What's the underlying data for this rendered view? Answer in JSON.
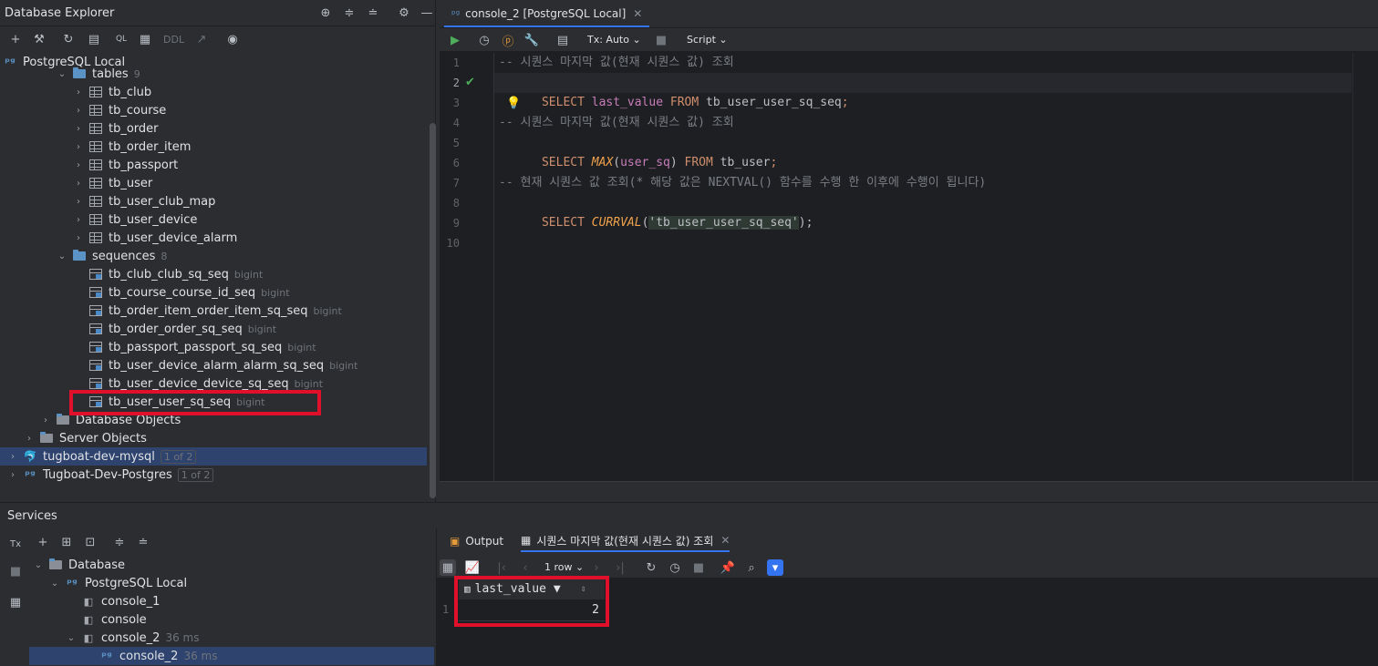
{
  "explorer": {
    "title": "Database Explorer",
    "toolbar_ddl": "DDL",
    "root": "PostgreSQL Local",
    "tables_folder": "tables",
    "tables_count": "9",
    "tables": [
      "tb_club",
      "tb_course",
      "tb_order",
      "tb_order_item",
      "tb_passport",
      "tb_user",
      "tb_user_club_map",
      "tb_user_device",
      "tb_user_device_alarm"
    ],
    "sequences_folder": "sequences",
    "sequences_count": "8",
    "sequences": [
      {
        "name": "tb_club_club_sq_seq",
        "type": "bigint"
      },
      {
        "name": "tb_course_course_id_seq",
        "type": "bigint"
      },
      {
        "name": "tb_order_item_order_item_sq_seq",
        "type": "bigint"
      },
      {
        "name": "tb_order_order_sq_seq",
        "type": "bigint"
      },
      {
        "name": "tb_passport_passport_sq_seq",
        "type": "bigint"
      },
      {
        "name": "tb_user_device_alarm_alarm_sq_seq",
        "type": "bigint"
      },
      {
        "name": "tb_user_device_device_sq_seq",
        "type": "bigint"
      },
      {
        "name": "tb_user_user_sq_seq",
        "type": "bigint"
      }
    ],
    "database_objects": "Database Objects",
    "server_objects": "Server Objects",
    "other_sources": [
      {
        "name": "tugboat-dev-mysql",
        "badge": "1 of 2"
      },
      {
        "name": "Tugboat-Dev-Postgres",
        "badge": "1 of 2"
      }
    ]
  },
  "editor": {
    "tab_label": "console_2 [PostgreSQL Local]",
    "tx_label": "Tx: Auto",
    "script_label": "Script",
    "line_numbers": [
      "1",
      "2",
      "3",
      "4",
      "5",
      "6",
      "7",
      "8",
      "9",
      "10"
    ],
    "lines": {
      "l1": "-- 시퀀스 마지막 값(현재 시퀀스 값) 조회",
      "l2_kw1": "SELECT",
      "l2_col": "last_value",
      "l2_kw2": "FROM",
      "l2_tbl": "tb_user_user_sq_seq",
      "l2_end": ";",
      "l4": "-- 시퀀스 마지막 값(현재 시퀀스 값) 조회",
      "l5_kw1": "SELECT",
      "l5_fn": "MAX",
      "l5_arg": "user_sq",
      "l5_kw2": "FROM",
      "l5_tbl": "tb_user",
      "l7": "-- 현재 시퀀스 값 조회(* 해당 값은 NEXTVAL() 함수를 수행 한 이후에 수행이 됩니다)",
      "l8_kw": "SELECT",
      "l8_fn": "CURRVAL",
      "l8_str": "'tb_user_user_sq_seq'",
      "l8_end": ");"
    }
  },
  "services": {
    "title": "Services",
    "tree": {
      "database": "Database",
      "root": "PostgreSQL Local",
      "consoles": [
        {
          "name": "console_1",
          "time": ""
        },
        {
          "name": "console",
          "time": ""
        },
        {
          "name": "console_2",
          "time": "36 ms"
        }
      ],
      "child": {
        "name": "console_2",
        "time": "36 ms"
      }
    },
    "tabs": {
      "output": "Output",
      "result": "시퀀스 마지막 값(현재 시퀀스 값) 조회"
    },
    "rows_label": "1 row",
    "grid": {
      "column": "last_value",
      "row_numbers": [
        "1"
      ],
      "values": [
        "2"
      ]
    }
  },
  "colors": {
    "accent": "#3574f0",
    "highlight_box": "#e0102b",
    "keyword": "#cf8e6d",
    "function": "#f0a24c",
    "string": "#6aab73",
    "comment": "#7a7e85"
  }
}
